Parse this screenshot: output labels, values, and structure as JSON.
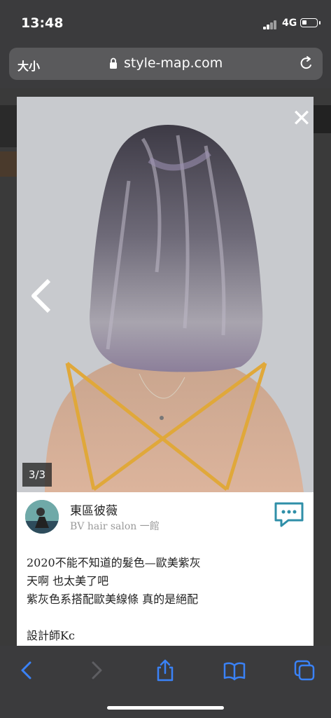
{
  "status": {
    "time": "13:48",
    "network": "4G"
  },
  "browser": {
    "text_size_label": "大小",
    "url": "style-map.com"
  },
  "modal": {
    "counter": "3/3",
    "author_name": "東區彼薇",
    "salon_name": "BV hair salon 一館",
    "post_lines": [
      "2020不能不知道的髮色—歐美紫灰",
      "天啊 也太美了吧",
      "紫灰色系搭配歐美線條 真的是絕配",
      "",
      "設計師Kc"
    ]
  },
  "icons": {
    "close": "close-icon",
    "prev": "chevron-left-icon",
    "chat": "chat-icon",
    "back": "back-icon",
    "forward": "forward-icon",
    "share": "share-icon",
    "bookmarks": "book-icon",
    "tabs": "tabs-icon"
  },
  "colors": {
    "accent": "#2f8fa8",
    "toolbar_icon": "#3a82f7"
  }
}
